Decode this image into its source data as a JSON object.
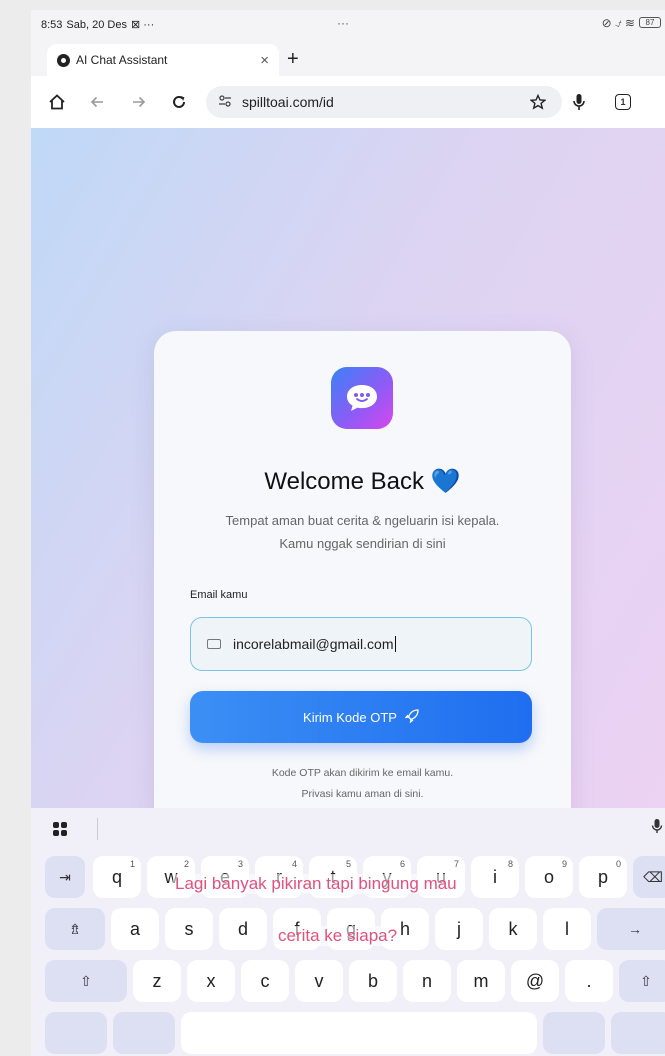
{
  "status_bar": {
    "time": "8:53",
    "date": "Sab, 20 Des",
    "extra_icons": "⊠ ···",
    "center_dots": "···",
    "right_icons": "⊘ ⍻ ≋",
    "battery": "87"
  },
  "browser": {
    "tab_title": "AI Chat Assistant",
    "tab_close": "×",
    "new_tab": "+",
    "url": "spilltoai.com/id",
    "tab_count": "1"
  },
  "login": {
    "title": "Welcome Back 💙",
    "subtitle_line1": "Tempat aman buat cerita & ngeluarin isi kepala.",
    "subtitle_line2": "Kamu nggak sendirian di sini",
    "email_label": "Email kamu",
    "email_value": "incorelabmail@gmail.com",
    "submit_label": "Kirim Kode OTP",
    "note_line1": "Kode OTP akan dikirim ke email kamu.",
    "note_line2": "Privasi kamu aman di sini."
  },
  "keyboard": {
    "row1": [
      {
        "key": "q",
        "num": "1"
      },
      {
        "key": "w",
        "num": "2"
      },
      {
        "key": "e",
        "num": "3"
      },
      {
        "key": "r",
        "num": "4"
      },
      {
        "key": "t",
        "num": "5"
      },
      {
        "key": "y",
        "num": "6"
      },
      {
        "key": "u",
        "num": "7"
      },
      {
        "key": "i",
        "num": "8"
      },
      {
        "key": "o",
        "num": "9"
      },
      {
        "key": "p",
        "num": "0"
      }
    ],
    "row2": [
      "a",
      "s",
      "d",
      "f",
      "g",
      "h",
      "j",
      "k",
      "l"
    ],
    "row3": [
      "z",
      "x",
      "c",
      "v",
      "b",
      "n",
      "m",
      "@",
      "."
    ],
    "tab_key": "⇥",
    "backspace_key": "⌫",
    "caps_key": "⇯",
    "enter_key": "→",
    "shift_key": "⇧"
  },
  "captions": {
    "line1": "Lagi banyak pikiran tapi bingung mau",
    "line2": "cerita ke siapa?"
  }
}
